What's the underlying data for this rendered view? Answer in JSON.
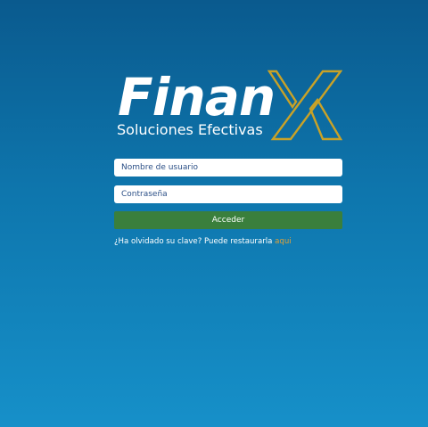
{
  "brand": {
    "logo_word": "Finan",
    "logo_letter": "X",
    "tagline": "Soluciones Efectivas",
    "accent_color": "#c9a227"
  },
  "login_form": {
    "username_placeholder": "Nombre de usuario",
    "password_placeholder": "Contraseña",
    "submit_label": "Acceder",
    "submit_color": "#3a7f3c"
  },
  "recovery": {
    "text": "¿Ha olvidado su clave? Puede restaurarla ",
    "link_label": "aqui",
    "link_color": "#e0a23a"
  }
}
